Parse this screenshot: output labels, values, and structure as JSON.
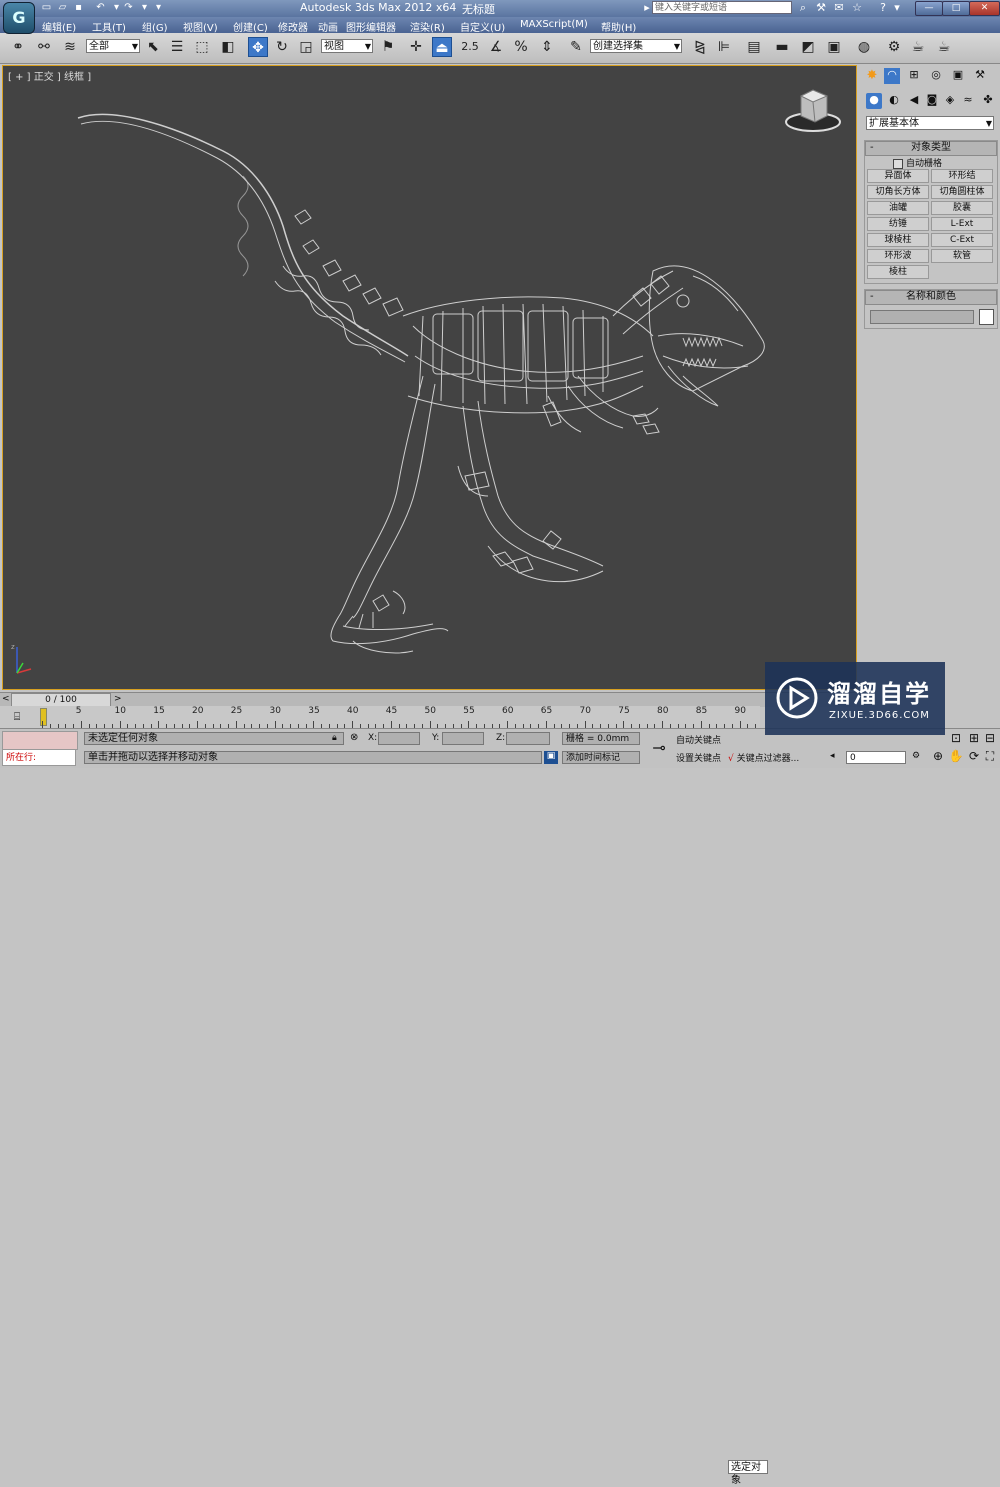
{
  "app": {
    "title": "Autodesk 3ds Max  2012 x64",
    "document": "无标题",
    "logo_letter": "G",
    "search_placeholder": "键入关键字或短语"
  },
  "menus": [
    "编辑(E)",
    "工具(T)",
    "组(G)",
    "视图(V)",
    "创建(C)",
    "修改器",
    "动画",
    "图形编辑器",
    "渲染(R)",
    "自定义(U)",
    "MAXScript(M)",
    "帮助(H)"
  ],
  "toolbar": {
    "selection_filter": "全部",
    "ref_coord": "视图",
    "snap_label": "2.5",
    "named_selection": "创建选择集"
  },
  "viewport": {
    "label": "[ + ] 正交 ] 线框 ]",
    "label_parts": [
      "+",
      "正交",
      "线框"
    ]
  },
  "command_panel": {
    "category": "扩展基本体",
    "object_type": {
      "title": "对象类型",
      "autogrid": "自动栅格",
      "buttons": [
        "异面体",
        "环形结",
        "切角长方体",
        "切角圆柱体",
        "油罐",
        "胶囊",
        "纺锤",
        "L-Ext",
        "球棱柱",
        "C-Ext",
        "环形波",
        "软管",
        "棱柱"
      ]
    },
    "name_color": {
      "title": "名称和颜色",
      "name_value": "",
      "swatch_color": "#ffffff"
    }
  },
  "timeline": {
    "frame_display": "0 / 100",
    "current_frame": 0,
    "total_frames": 100,
    "ticks": [
      "0",
      "5",
      "10",
      "15",
      "20",
      "25",
      "30",
      "35",
      "40",
      "45",
      "50",
      "55",
      "60",
      "65",
      "70",
      "75",
      "80",
      "85",
      "90"
    ]
  },
  "status": {
    "mode": "所在行:",
    "selection_text": "未选定任何对象",
    "prompt": "单击并拖动以选择并移动对象",
    "x_label": "X:",
    "y_label": "Y:",
    "z_label": "Z:",
    "grid": "栅格 = 0.0mm",
    "add_time_tag": "添加时间标记",
    "auto_key": "自动关键点",
    "set_key": "设置关键点",
    "selected_dropdown": "选定对象",
    "key_filters": "关键点过滤器...",
    "frame_field": "0"
  },
  "watermark": {
    "brand": "溜溜自学",
    "url": "ZIXUE.3D66.COM"
  },
  "colors": {
    "viewport_bg": "#434343",
    "active_border": "#d8a020",
    "titlebar": "#6a84ad",
    "wireframe": "#e6e6e6",
    "active_tool": "#3d78c8"
  },
  "icons": [
    "undo-icon",
    "redo-icon",
    "select-icon",
    "move-icon",
    "rotate-icon",
    "scale-icon",
    "mirror-icon",
    "align-icon",
    "render-icon",
    "key-icon",
    "play-icon",
    "zoom-icon",
    "pan-icon",
    "orbit-icon",
    "help-icon",
    "star-icon"
  ]
}
